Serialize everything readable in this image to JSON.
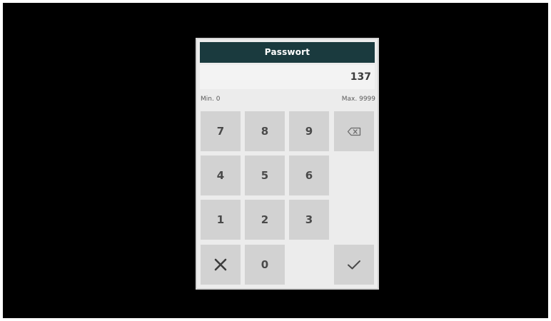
{
  "dialog": {
    "title": "Passwort",
    "value": "137",
    "min_label": "Min. 0",
    "max_label": "Max. 9999"
  },
  "keypad": {
    "keys": [
      "7",
      "8",
      "9",
      "4",
      "5",
      "6",
      "1",
      "2",
      "3",
      "0"
    ],
    "icons": {
      "backspace": "backspace-icon",
      "cancel": "close-icon",
      "confirm": "checkmark-icon"
    }
  },
  "colors": {
    "title_bar": "#1a3a3e",
    "dialog_bg": "#ececec",
    "key_bg": "#d2d2d2"
  }
}
